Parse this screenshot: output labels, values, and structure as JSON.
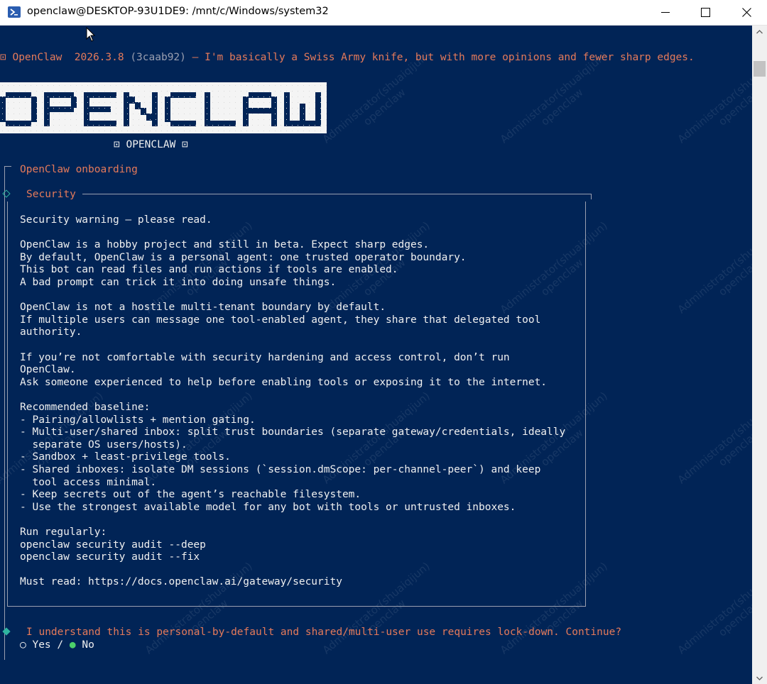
{
  "window": {
    "title": "openclaw@DESKTOP-93U1DE9: /mnt/c/Windows/system32"
  },
  "terminal": {
    "header_prefix": "⊡ OpenClaw  2026.3.8 ",
    "header_commit": "(3caab92)",
    "header_tagline": " — I'm basically a Swiss Army knife, but with more opinions and fewer sharp edges.",
    "banner_text": "OPENCLAW",
    "banner_caption": "⊡ OPENCLAW ⊡",
    "onboarding_title": "OpenClaw onboarding",
    "section_title": "Security",
    "security_lines": [
      "Security warning — please read.",
      "",
      "OpenClaw is a hobby project and still in beta. Expect sharp edges.",
      "By default, OpenClaw is a personal agent: one trusted operator boundary.",
      "This bot can read files and run actions if tools are enabled.",
      "A bad prompt can trick it into doing unsafe things.",
      "",
      "OpenClaw is not a hostile multi-tenant boundary by default.",
      "If multiple users can message one tool-enabled agent, they share that delegated tool",
      "authority.",
      "",
      "If you’re not comfortable with security hardening and access control, don’t run",
      "OpenClaw.",
      "Ask someone experienced to help before enabling tools or exposing it to the internet.",
      "",
      "Recommended baseline:",
      "- Pairing/allowlists + mention gating.",
      "- Multi-user/shared inbox: split trust boundaries (separate gateway/credentials, ideally",
      "  separate OS users/hosts).",
      "- Sandbox + least-privilege tools.",
      "- Shared inboxes: isolate DM sessions (`session.dmScope: per-channel-peer`) and keep",
      "  tool access minimal.",
      "- Keep secrets out of the agent’s reachable filesystem.",
      "- Use the strongest available model for any bot with tools or untrusted inboxes.",
      "",
      "Run regularly:",
      "openclaw security audit --deep",
      "openclaw security audit --fix",
      "",
      "Must read: https://docs.openclaw.ai/gateway/security"
    ],
    "prompt_question": "I understand this is personal-by-default and shared/multi-user use requires lock-down. Continue?",
    "option_yes": "Yes",
    "option_separator": "/",
    "option_no": "No",
    "selected_option": "No"
  },
  "watermark": {
    "user": "Administrator(shuaiqijun)",
    "app": "openclaw"
  },
  "colors": {
    "terminal_bg": "#012456",
    "accent_orange": "#e57a5a",
    "active_green": "#4cd06a",
    "diamond_teal": "#2fb5a0"
  },
  "icons": {
    "app": "powershell-icon",
    "minimize": "minimize-icon",
    "maximize": "maximize-icon",
    "close": "close-icon"
  }
}
